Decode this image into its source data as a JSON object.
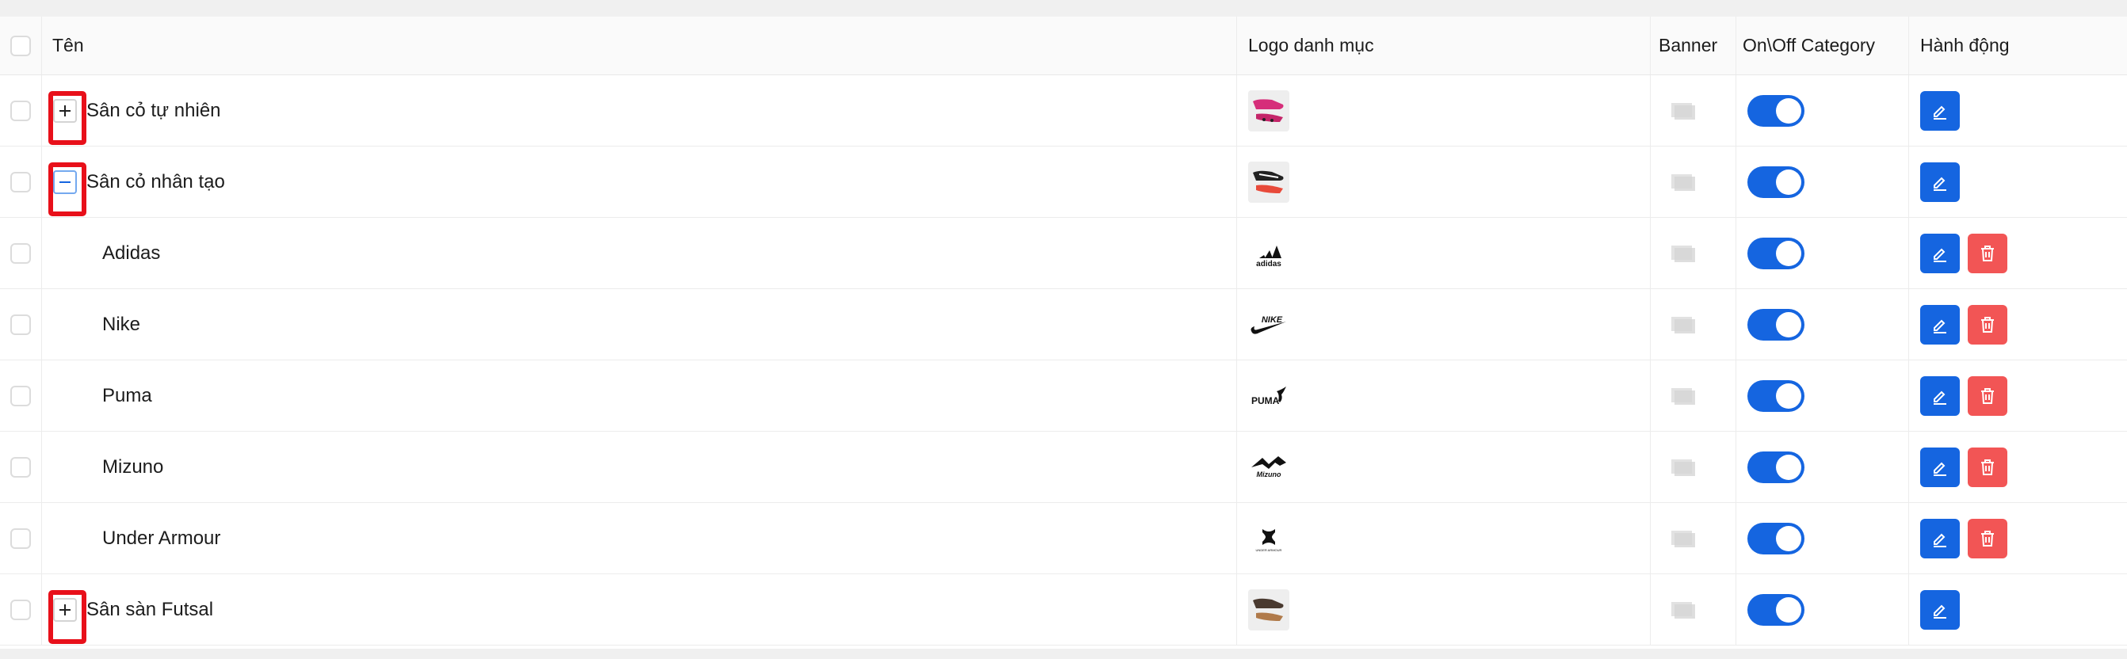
{
  "colors": {
    "primary": "#1565e0",
    "danger": "#f25555",
    "highlight": "#e8101a"
  },
  "table": {
    "headers": {
      "name": "Tên",
      "logo": "Logo danh mục",
      "banner": "Banner",
      "onoff": "On\\Off Category",
      "action": "Hành động"
    },
    "rows": [
      {
        "name": "Sân cỏ tự nhiên",
        "level": "parent",
        "expander": "plus",
        "logo_icon": "boot-pink-icon",
        "enabled": true,
        "actions": [
          "edit"
        ]
      },
      {
        "name": "Sân cỏ nhân tạo",
        "level": "parent",
        "expander": "minus",
        "logo_icon": "boot-black-red-icon",
        "enabled": true,
        "actions": [
          "edit"
        ]
      },
      {
        "name": "Adidas",
        "level": "child",
        "logo_icon": "adidas-logo",
        "logo_text": "adidas",
        "enabled": true,
        "actions": [
          "edit",
          "delete"
        ]
      },
      {
        "name": "Nike",
        "level": "child",
        "logo_icon": "nike-logo",
        "logo_text": "NIKE",
        "enabled": true,
        "actions": [
          "edit",
          "delete"
        ]
      },
      {
        "name": "Puma",
        "level": "child",
        "logo_icon": "puma-logo",
        "logo_text": "PUMA",
        "enabled": true,
        "actions": [
          "edit",
          "delete"
        ]
      },
      {
        "name": "Mizuno",
        "level": "child",
        "logo_icon": "mizuno-logo",
        "logo_text": "Mizuno",
        "enabled": true,
        "actions": [
          "edit",
          "delete"
        ]
      },
      {
        "name": "Under Armour",
        "level": "child",
        "logo_icon": "under-armour-logo",
        "logo_text": "UNDER ARMOUR",
        "enabled": true,
        "actions": [
          "edit",
          "delete"
        ]
      },
      {
        "name": "Sân sàn Futsal",
        "level": "parent",
        "expander": "plus",
        "logo_icon": "boot-brown-icon",
        "enabled": true,
        "actions": [
          "edit"
        ]
      }
    ]
  }
}
